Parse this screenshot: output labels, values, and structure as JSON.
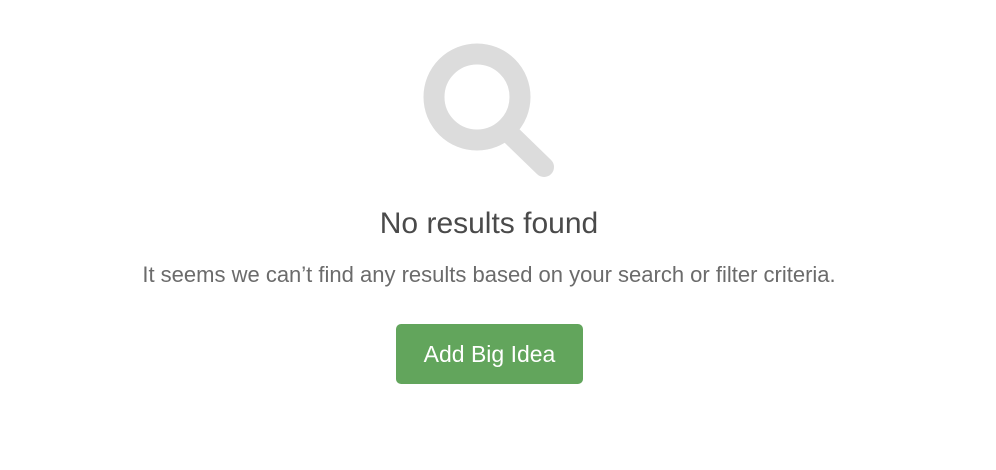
{
  "empty_state": {
    "icon": "search-icon",
    "icon_color": "#dcdcdc",
    "title": "No results found",
    "message": "It seems we can’t find any results based on your search or filter criteria.",
    "button_label": "Add Big Idea",
    "button_color": "#62a55c"
  }
}
